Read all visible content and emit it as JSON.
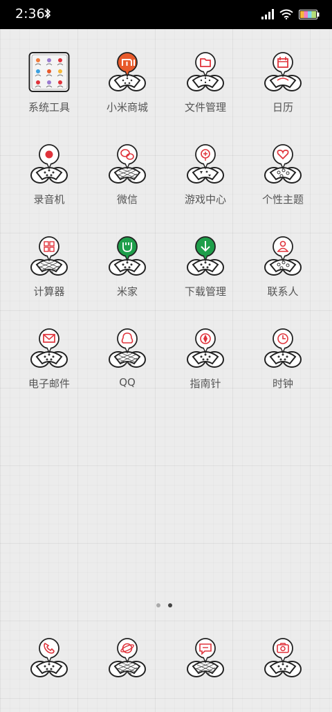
{
  "status_bar": {
    "time": "2:36",
    "icons": [
      "bluetooth-icon",
      "signal-icon",
      "wifi-icon",
      "battery-icon"
    ]
  },
  "accent_colors": {
    "red": "#e0333b",
    "xiaomi_orange": "#e85a2b",
    "green": "#1e9e4a",
    "ink": "#222222"
  },
  "apps": [
    {
      "label": "系统工具",
      "icon": "folder-icon"
    },
    {
      "label": "小米商城",
      "icon": "mi-store-icon"
    },
    {
      "label": "文件管理",
      "icon": "file-manager-icon"
    },
    {
      "label": "日历",
      "icon": "calendar-icon"
    },
    {
      "label": "录音机",
      "icon": "recorder-icon"
    },
    {
      "label": "微信",
      "icon": "wechat-icon"
    },
    {
      "label": "游戏中心",
      "icon": "game-center-icon"
    },
    {
      "label": "个性主题",
      "icon": "themes-icon"
    },
    {
      "label": "计算器",
      "icon": "calculator-icon"
    },
    {
      "label": "米家",
      "icon": "mijia-icon"
    },
    {
      "label": "下载管理",
      "icon": "downloads-icon"
    },
    {
      "label": "联系人",
      "icon": "contacts-icon"
    },
    {
      "label": "电子邮件",
      "icon": "email-icon"
    },
    {
      "label": "QQ",
      "icon": "qq-icon"
    },
    {
      "label": "指南针",
      "icon": "compass-icon"
    },
    {
      "label": "时钟",
      "icon": "clock-icon"
    }
  ],
  "page_indicator": {
    "pages": 2,
    "current": 2
  },
  "dock": [
    {
      "icon": "phone-icon"
    },
    {
      "icon": "browser-icon"
    },
    {
      "icon": "messages-icon"
    },
    {
      "icon": "camera-icon"
    }
  ]
}
